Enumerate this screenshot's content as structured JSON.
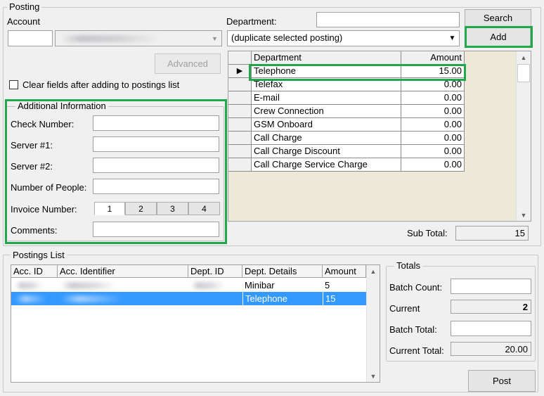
{
  "posting": {
    "group_label": "Posting",
    "account_label": "Account",
    "department_label": "Department:",
    "department_combo_value": "(duplicate selected posting)",
    "search_label": "Search",
    "add_label": "Add",
    "advanced_label": "Advanced",
    "clear_fields_label": "Clear fields after adding to postings list",
    "subtotal_label": "Sub Total:",
    "subtotal_value": "15"
  },
  "additional_info": {
    "title": "Additional Information",
    "check_number_label": "Check Number:",
    "server1_label": "Server #1:",
    "server2_label": "Server #2:",
    "people_label": "Number of People:",
    "invoice_label": "Invoice Number:",
    "invoice_tabs": [
      "1",
      "2",
      "3",
      "4"
    ],
    "comments_label": "Comments:"
  },
  "dept_grid": {
    "headers": [
      "Department",
      "Amount"
    ],
    "rows": [
      {
        "department": "Telephone",
        "amount": "15.00"
      },
      {
        "department": "Telefax",
        "amount": "0.00"
      },
      {
        "department": "E-mail",
        "amount": "0.00"
      },
      {
        "department": "Crew Connection",
        "amount": "0.00"
      },
      {
        "department": "GSM Onboard",
        "amount": "0.00"
      },
      {
        "department": "Call Charge",
        "amount": "0.00"
      },
      {
        "department": "Call Charge Discount",
        "amount": "0.00"
      },
      {
        "department": "Call Charge Service Charge",
        "amount": "0.00"
      }
    ]
  },
  "postings_list": {
    "title": "Postings List",
    "headers": [
      "Acc. ID",
      "Acc. Identifier",
      "Dept. ID",
      "Dept. Details",
      "Amount"
    ],
    "rows": [
      {
        "dept_details": "Minibar",
        "amount": "5"
      },
      {
        "dept_details": "Telephone",
        "amount": "15"
      }
    ]
  },
  "totals": {
    "title": "Totals",
    "batch_count_label": "Batch Count:",
    "current_label": "Current",
    "current_value": "2",
    "batch_total_label": "Batch Total:",
    "current_total_label": "Current Total:",
    "current_total_value": "20.00",
    "post_label": "Post"
  },
  "colors": {
    "highlight": "#22a84a",
    "selection": "#3399ff"
  }
}
